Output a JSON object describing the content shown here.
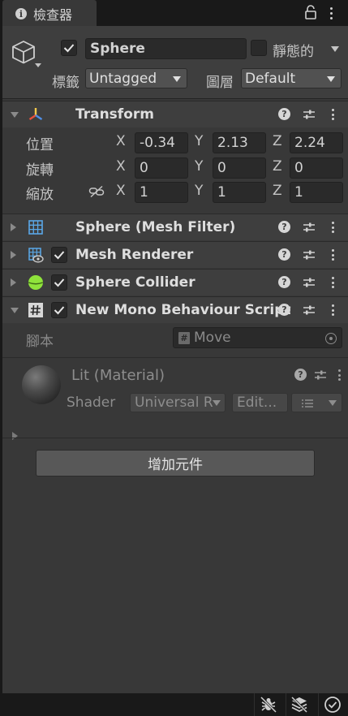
{
  "tab": {
    "title": "檢查器",
    "icon": "info-icon"
  },
  "header": {
    "name": "Sphere",
    "active": true,
    "static_label": "靜態的",
    "static_checked": false,
    "tag_label": "標籤",
    "tag_value": "Untagged",
    "layer_label": "圖層",
    "layer_value": "Default"
  },
  "transform": {
    "title": "Transform",
    "rows": [
      {
        "label": "位置",
        "x": "-0.34",
        "y": "2.13",
        "z": "2.24"
      },
      {
        "label": "旋轉",
        "x": "0",
        "y": "0",
        "z": "0"
      },
      {
        "label": "縮放",
        "x": "1",
        "y": "1",
        "z": "1"
      }
    ],
    "axis_x": "X",
    "axis_y": "Y",
    "axis_z": "Z"
  },
  "components": [
    {
      "title": "Sphere (Mesh Filter)",
      "icon": "mesh-filter-icon",
      "has_checkbox": false
    },
    {
      "title": "Mesh Renderer",
      "icon": "mesh-renderer-icon",
      "has_checkbox": true,
      "checked": true
    },
    {
      "title": "Sphere Collider",
      "icon": "sphere-collider-icon",
      "has_checkbox": true,
      "checked": true
    },
    {
      "title": "New Mono Behaviour Script",
      "icon": "script-icon",
      "has_checkbox": true,
      "checked": true
    }
  ],
  "script": {
    "label": "腳本",
    "value": "Move"
  },
  "material": {
    "title": "Lit (Material)",
    "shader_label": "Shader",
    "shader_value": "Universal R",
    "edit_label": "Edit..."
  },
  "add_component_label": "增加元件",
  "colors": {
    "panel": "#383838",
    "header": "#3e3e3e",
    "field": "#2a2a2a",
    "accent_green": "#8fe33b",
    "axis_red": "#e8503a",
    "axis_yellow": "#f2c94c",
    "axis_blue": "#4f8fe8"
  }
}
